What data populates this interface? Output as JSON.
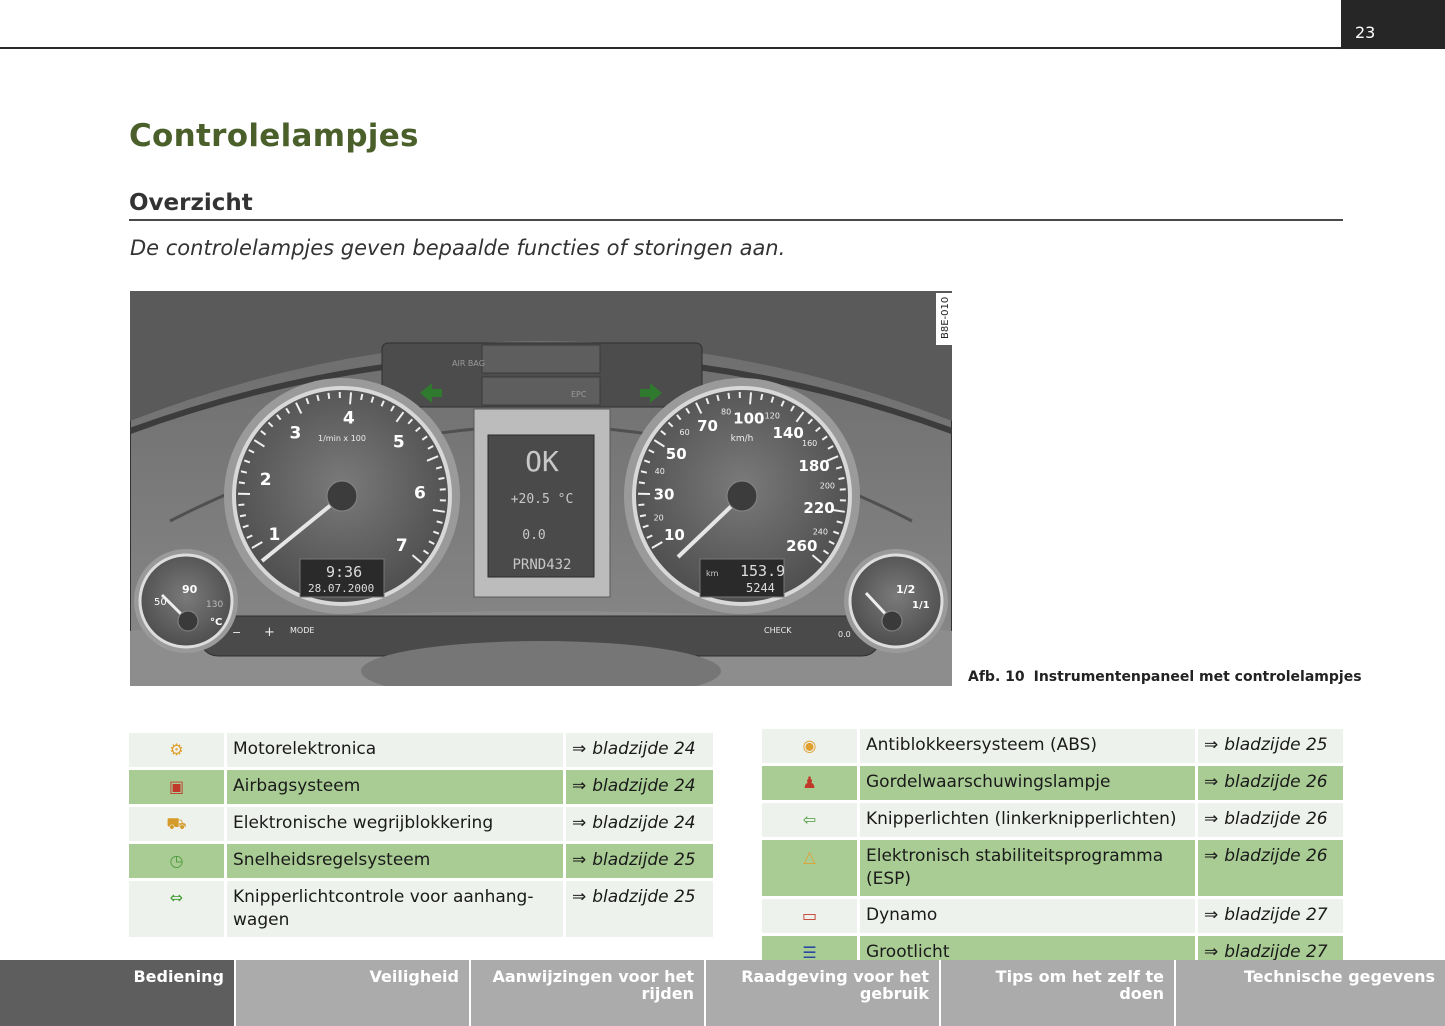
{
  "page_number": "23",
  "chapter_title": "Controlelampjes",
  "section_title": "Overzicht",
  "intro": "De controlelampjes geven bepaalde functies of storingen aan.",
  "figure": {
    "code": "B8E-010",
    "caption_number": "Afb. 10",
    "caption_text": "Instrumentenpaneel met controlelampjes",
    "tach_unit": "1/min x 100",
    "tach_labels": [
      "1",
      "2",
      "3",
      "4",
      "5",
      "6",
      "7"
    ],
    "speed_unit": "km/h",
    "speed_labels": [
      "10",
      "30",
      "50",
      "70",
      "100",
      "140",
      "180",
      "220",
      "260"
    ],
    "speed_minor_labels": [
      "20",
      "40",
      "60",
      "80",
      "120",
      "160",
      "200",
      "240"
    ],
    "temp_labels": [
      "50",
      "90",
      "130",
      "°C"
    ],
    "fuel_labels": [
      "1/2",
      "1/1"
    ],
    "clock": "9:36",
    "date": "28.07.2000",
    "display_status": "OK",
    "display_temp": "+20.5 °C",
    "display_consumption": "0.0",
    "display_gear": "PRND432",
    "trip": "153.9",
    "odometer": "5244",
    "odometer_unit": "km",
    "buttons": {
      "minus": "−",
      "plus": "+",
      "mode": "MODE",
      "check": "CHECK",
      "reset": "0.0"
    },
    "warning_panel": {
      "air": "AIR BAG",
      "epc": "EPC"
    }
  },
  "table_left": [
    {
      "icon": "engine-electronics-icon",
      "color": "#e0a030",
      "label": "Motorelektronica",
      "page": "bladzijde 24"
    },
    {
      "icon": "airbag-icon",
      "color": "#c0392b",
      "label": "Airbagsysteem",
      "page": "bladzijde 24"
    },
    {
      "icon": "immobilizer-car-icon",
      "color": "#d49a2a",
      "label": "Elektronische wegrijblokkering",
      "page": "bladzijde 24"
    },
    {
      "icon": "cruise-control-icon",
      "color": "#4a9a3a",
      "label": "Snelheidsregelsysteem",
      "page": "bladzijde 25"
    },
    {
      "icon": "trailer-indicator-icon",
      "color": "#4aa03a",
      "label": "Knipperlichtcontrole voor aanhang-wagen",
      "page": "bladzijde 25"
    }
  ],
  "table_right": [
    {
      "icon": "abs-icon",
      "color": "#e0a030",
      "label": "Antiblokkeersysteem (ABS)",
      "page": "bladzijde 25"
    },
    {
      "icon": "seatbelt-icon",
      "color": "#c0392b",
      "label": "Gordelwaarschuwingslampje",
      "page": "bladzijde 26"
    },
    {
      "icon": "turn-signal-icon",
      "color": "#4a9a3a",
      "label": "Knipperlichten (linkerknipperlichten)",
      "page": "bladzijde 26"
    },
    {
      "icon": "esp-icon",
      "color": "#e0a030",
      "label": "Elektronisch stabiliteitsprogramma (ESP)",
      "page": "bladzijde 26"
    },
    {
      "icon": "alternator-icon",
      "color": "#c0392b",
      "label": "Dynamo",
      "page": "bladzijde 27"
    },
    {
      "icon": "high-beam-icon",
      "color": "#2a4aa0",
      "label": "Grootlicht",
      "page": "bladzijde 27"
    }
  ],
  "page_ref_arrow": "⇒",
  "footer_tabs": [
    {
      "label": "Bediening",
      "active": true
    },
    {
      "label": "Veiligheid",
      "active": false
    },
    {
      "label": "Aanwijzingen voor het rijden",
      "active": false
    },
    {
      "label": "Raadgeving voor het gebruik",
      "active": false
    },
    {
      "label": "Tips om het zelf te doen",
      "active": false
    },
    {
      "label": "Technische gegevens",
      "active": false
    }
  ]
}
